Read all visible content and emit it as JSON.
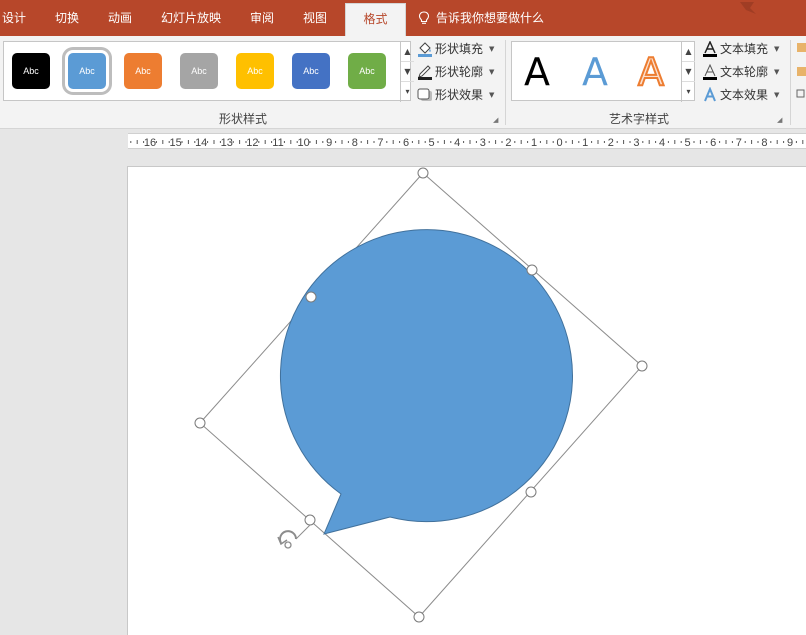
{
  "tabs": [
    "设计",
    "切换",
    "动画",
    "幻灯片放映",
    "审阅",
    "视图",
    "格式"
  ],
  "active_tab": "格式",
  "tell_me": "告诉我你想要做什么",
  "shape_styles": {
    "items": [
      {
        "label": "Abc",
        "color": "#000000"
      },
      {
        "label": "Abc",
        "color": "#5b9bd5"
      },
      {
        "label": "Abc",
        "color": "#ed7d31"
      },
      {
        "label": "Abc",
        "color": "#a5a5a5"
      },
      {
        "label": "Abc",
        "color": "#ffc000"
      },
      {
        "label": "Abc",
        "color": "#4472c4"
      },
      {
        "label": "Abc",
        "color": "#70ad47"
      }
    ],
    "selected_index": 1,
    "fill": "形状填充",
    "outline": "形状轮廓",
    "effects": "形状效果",
    "group_label": "形状样式"
  },
  "wordart_styles": {
    "samples": [
      {
        "letter": "A",
        "color": "#000000"
      },
      {
        "letter": "A",
        "color": "#5b9bd5"
      },
      {
        "letter": "A",
        "color": "#ed7d31"
      }
    ],
    "text_fill": "文本填充",
    "text_outline": "文本轮廓",
    "text_effects": "文本效果",
    "group_label": "艺术字样式"
  },
  "ruler": {
    "labels": [
      "16",
      "15",
      "14",
      "13",
      "12",
      "11",
      "10",
      "9",
      "8",
      "7",
      "6",
      "5",
      "4",
      "3",
      "2",
      "1",
      "0",
      "1",
      "2",
      "3",
      "4",
      "5",
      "6",
      "7",
      "8",
      "9"
    ]
  },
  "shape": {
    "type": "speech-bubble-oval",
    "fill": "#5b9bd5",
    "outline": "#41719c"
  },
  "colors": {
    "tab_bar": "#b7472a",
    "ribbon_bg": "#f3f3f3",
    "selection_line": "#8c8c8c"
  }
}
